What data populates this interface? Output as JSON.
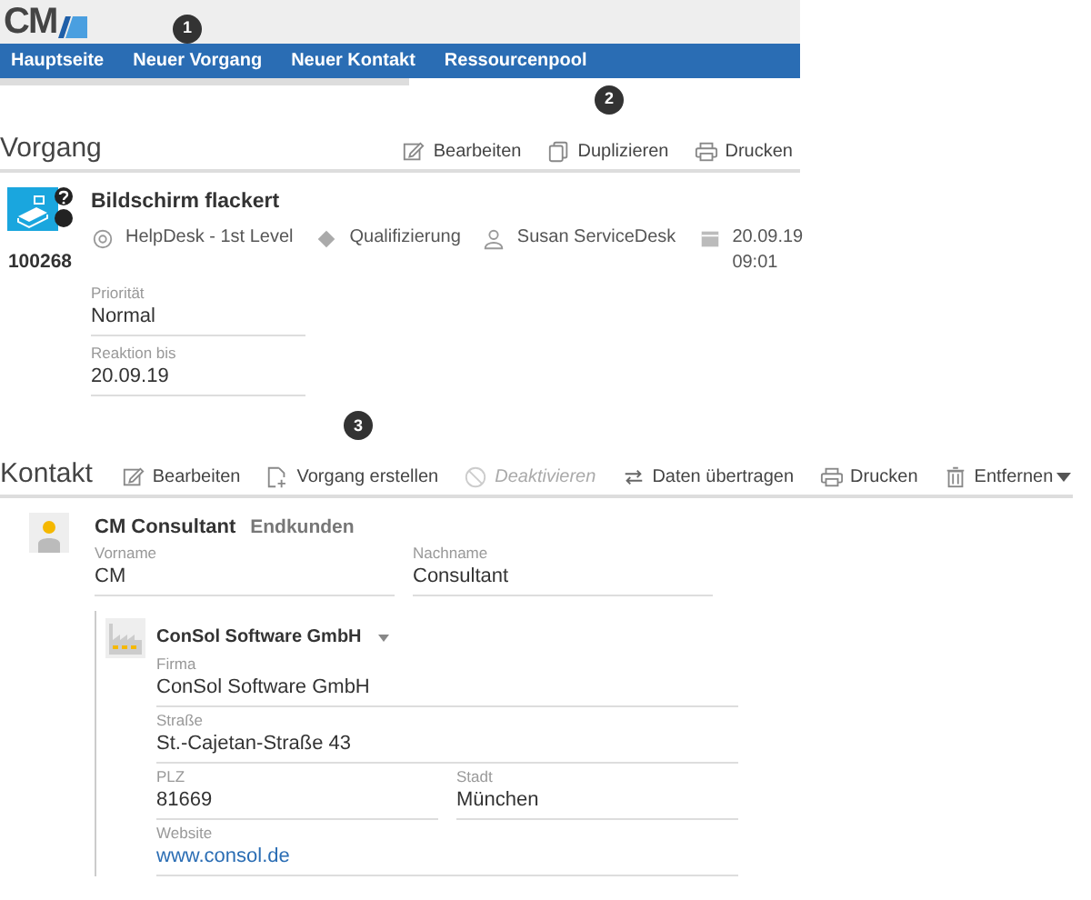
{
  "logo": {
    "text": "CM"
  },
  "nav": {
    "callout": "1",
    "items": [
      {
        "label": "Hauptseite"
      },
      {
        "label": "Neuer Vorgang"
      },
      {
        "label": "Neuer Kontakt"
      },
      {
        "label": "Ressourcenpool"
      }
    ]
  },
  "vorgang": {
    "title": "Vorgang",
    "callout": "2",
    "actions": [
      {
        "label": "Bearbeiten",
        "kind": "edit",
        "disabled": false
      },
      {
        "label": "Duplizieren",
        "kind": "copy",
        "disabled": false
      },
      {
        "label": "Drucken",
        "kind": "print",
        "disabled": false
      }
    ],
    "case": {
      "number": "100268",
      "title": "Bildschirm flackert",
      "meta": [
        {
          "kind": "gear",
          "text": "HelpDesk - 1st Level"
        },
        {
          "kind": "diamond",
          "text": "Qualifizierung"
        },
        {
          "kind": "user",
          "text": "Susan ServiceDesk"
        },
        {
          "kind": "calendar",
          "text": "20.09.19 09:01"
        }
      ],
      "fields": [
        {
          "label": "Priorität",
          "value": "Normal"
        },
        {
          "label": "Reaktion bis",
          "value": "20.09.19"
        }
      ]
    }
  },
  "kontakt": {
    "title": "Kontakt",
    "callout": "3",
    "actions": [
      {
        "label": "Bearbeiten",
        "kind": "edit",
        "disabled": false
      },
      {
        "label": "Vorgang erstellen",
        "kind": "add",
        "disabled": false
      },
      {
        "label": "Deaktivieren",
        "kind": "ban",
        "disabled": true
      },
      {
        "label": "Daten übertragen",
        "kind": "transfer",
        "disabled": false
      },
      {
        "label": "Drucken",
        "kind": "print",
        "disabled": false
      },
      {
        "label": "Entfernen",
        "kind": "trash",
        "disabled": false,
        "dropdown": true
      }
    ],
    "contact": {
      "name": "CM Consultant",
      "type": "Endkunden",
      "fields": [
        [
          {
            "label": "Vorname",
            "value": "CM"
          },
          {
            "label": "Nachname",
            "value": "Consultant"
          }
        ]
      ]
    },
    "company": {
      "name": "ConSol Software GmbH",
      "fields": [
        [
          {
            "label": "Firma",
            "value": "ConSol Software GmbH"
          }
        ],
        [
          {
            "label": "Straße",
            "value": "St.-Cajetan-Straße 43"
          }
        ],
        [
          {
            "label": "PLZ",
            "value": "81669"
          },
          {
            "label": "Stadt",
            "value": "München"
          }
        ],
        [
          {
            "label": "Website",
            "value": "www.consol.de",
            "kind": "link"
          }
        ]
      ]
    }
  }
}
